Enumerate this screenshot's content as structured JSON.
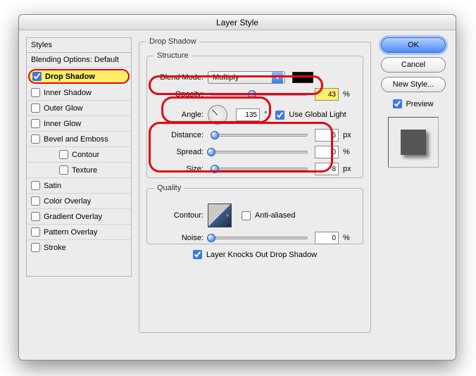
{
  "window": {
    "title": "Layer Style"
  },
  "sidebar": {
    "header": "Styles",
    "items": [
      {
        "label": "Blending Options: Default",
        "checked": null
      },
      {
        "label": "Drop Shadow",
        "checked": true,
        "active": true
      },
      {
        "label": "Inner Shadow",
        "checked": false
      },
      {
        "label": "Outer Glow",
        "checked": false
      },
      {
        "label": "Inner Glow",
        "checked": false
      },
      {
        "label": "Bevel and Emboss",
        "checked": false
      },
      {
        "label": "Contour",
        "checked": false,
        "sub": true
      },
      {
        "label": "Texture",
        "checked": false,
        "sub": true
      },
      {
        "label": "Satin",
        "checked": false
      },
      {
        "label": "Color Overlay",
        "checked": false
      },
      {
        "label": "Gradient Overlay",
        "checked": false
      },
      {
        "label": "Pattern Overlay",
        "checked": false
      },
      {
        "label": "Stroke",
        "checked": false
      }
    ]
  },
  "panel": {
    "title": "Drop Shadow",
    "structure_title": "Structure",
    "quality_title": "Quality",
    "blend_label": "Blend Mode:",
    "blend_value": "Multiply",
    "color": "#000000",
    "opacity_label": "Opacity:",
    "opacity_value": "43",
    "opacity_unit": "%",
    "angle_label": "Angle:",
    "angle_value": "135",
    "angle_unit": "°",
    "global_light_label": "Use Global Light",
    "global_light_checked": true,
    "distance_label": "Distance:",
    "distance_value": "6",
    "distance_unit": "px",
    "spread_label": "Spread:",
    "spread_value": "0",
    "spread_unit": "%",
    "size_label": "Size:",
    "size_value": "8",
    "size_unit": "px",
    "contour_label": "Contour:",
    "antialias_label": "Anti-aliased",
    "antialias_checked": false,
    "noise_label": "Noise:",
    "noise_value": "0",
    "noise_unit": "%",
    "knockout_label": "Layer Knocks Out Drop Shadow",
    "knockout_checked": true
  },
  "buttons": {
    "ok": "OK",
    "cancel": "Cancel",
    "new_style": "New Style...",
    "preview": "Preview",
    "preview_checked": true
  }
}
